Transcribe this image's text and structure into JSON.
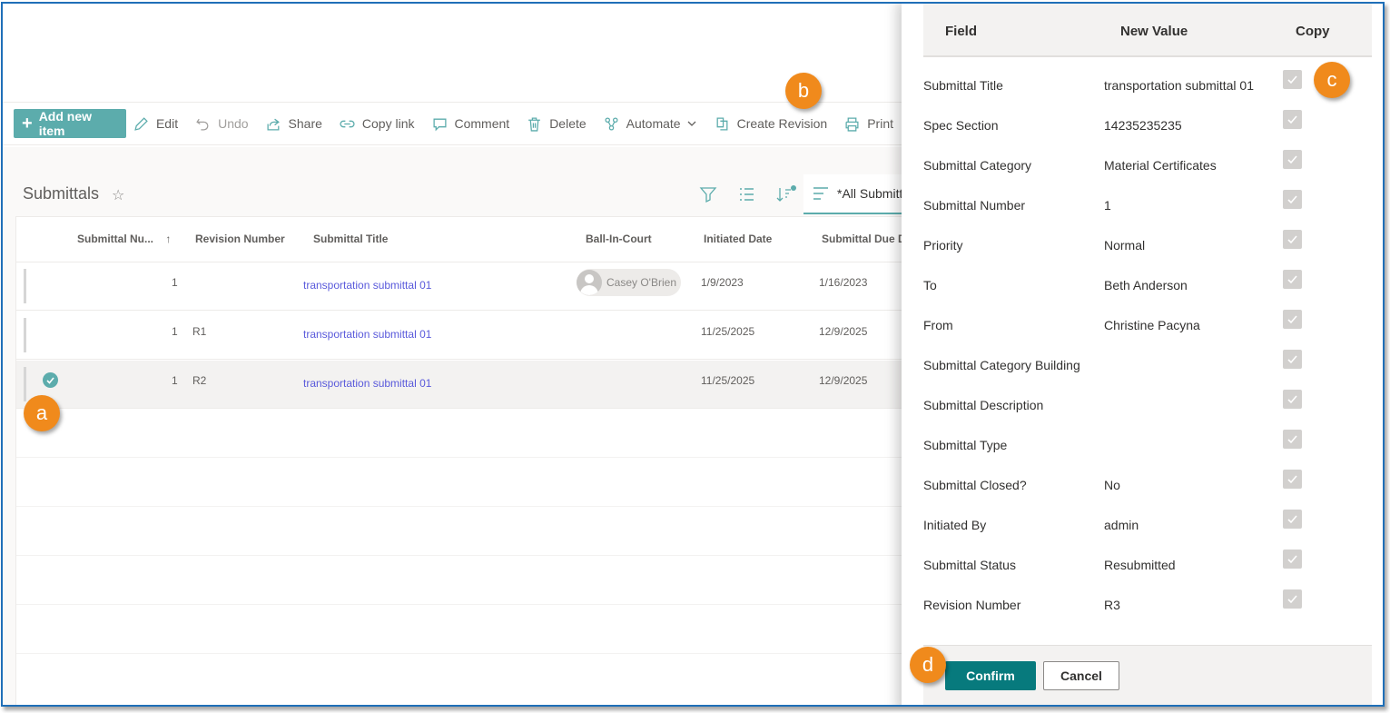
{
  "toolbar": {
    "add_new_item": "Add new item",
    "edit": "Edit",
    "undo": "Undo",
    "share": "Share",
    "copy_link": "Copy link",
    "comment": "Comment",
    "delete": "Delete",
    "automate": "Automate",
    "create_revision": "Create Revision",
    "print": "Print"
  },
  "list": {
    "title": "Submittals",
    "view_name": "*All Submitt",
    "columns": [
      "Submittal Nu...",
      "Revision Number",
      "Submittal Title",
      "Ball-In-Court",
      "Initiated Date",
      "Submittal Due D"
    ],
    "rows": [
      {
        "number": "1",
        "revision": "",
        "title": "transportation submittal 01",
        "ball_in_court": "Casey O'Brien",
        "initiated": "1/9/2023",
        "due": "1/16/2023"
      },
      {
        "number": "1",
        "revision": "R1",
        "title": "transportation submittal 01",
        "ball_in_court": "",
        "initiated": "11/25/2025",
        "due": "12/9/2025"
      },
      {
        "number": "1",
        "revision": "R2",
        "title": "transportation submittal 01",
        "ball_in_court": "",
        "initiated": "11/25/2025",
        "due": "12/9/2025"
      }
    ]
  },
  "panel": {
    "headers": {
      "field": "Field",
      "new_value": "New Value",
      "copy": "Copy"
    },
    "fields": [
      {
        "label": "Submittal Title",
        "value": "transportation submittal 01"
      },
      {
        "label": "Spec Section",
        "value": "14235235235"
      },
      {
        "label": "Submittal Category",
        "value": "Material Certificates"
      },
      {
        "label": "Submittal Number",
        "value": "1"
      },
      {
        "label": "Priority",
        "value": "Normal"
      },
      {
        "label": "To",
        "value": "Beth Anderson"
      },
      {
        "label": "From",
        "value": "Christine Pacyna"
      },
      {
        "label": "Submittal Category Building",
        "value": ""
      },
      {
        "label": "Submittal Description",
        "value": ""
      },
      {
        "label": "Submittal Type",
        "value": ""
      },
      {
        "label": "Submittal Closed?",
        "value": "No"
      },
      {
        "label": "Initiated By",
        "value": "admin"
      },
      {
        "label": "Submittal Status",
        "value": "Resubmitted"
      },
      {
        "label": "Revision Number",
        "value": "R3"
      }
    ],
    "confirm": "Confirm",
    "cancel": "Cancel"
  },
  "callouts": {
    "a": "a",
    "b": "b",
    "c": "c",
    "d": "d"
  },
  "colors": {
    "accent": "#5cacac",
    "confirm": "#077a7d",
    "callout": "#f08a1c",
    "link": "#5a5adb",
    "frame": "#1f6fb8"
  }
}
